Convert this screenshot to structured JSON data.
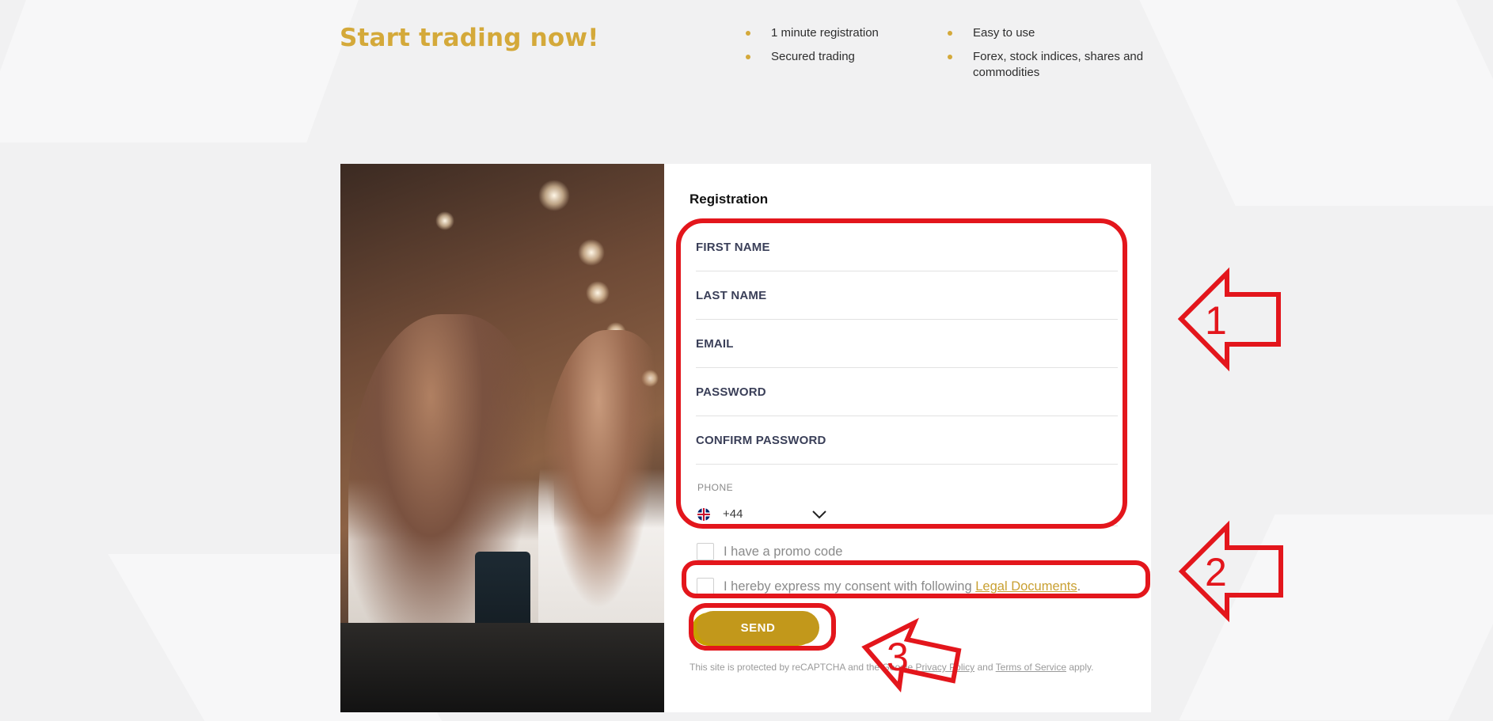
{
  "headline": "Start trading now!",
  "features": {
    "col1": [
      "1 minute registration",
      "Secured trading"
    ],
    "col2": [
      "Easy to use",
      "Forex, stock indices, shares and commodities"
    ]
  },
  "form": {
    "title": "Registration",
    "fields": [
      "FIRST NAME",
      "LAST NAME",
      "EMAIL",
      "PASSWORD",
      "CONFIRM PASSWORD"
    ],
    "phone_label": "PHONE",
    "dial_code": "+44",
    "promo_label": "I have a promo code",
    "consent_text": "I hereby express my consent with following ",
    "consent_link": "Legal Documents",
    "consent_end": ".",
    "send_label": "SEND",
    "recaptcha": {
      "prefix": "This site is protected by reCAPTCHA and the Google ",
      "privacy": "Privacy Policy",
      "and": " and ",
      "terms": "Terms of Service",
      "suffix": " apply."
    }
  },
  "annotations": [
    "1",
    "2",
    "3"
  ],
  "colors": {
    "accent": "#d4a93a",
    "button": "#c2981b",
    "annotation": "#e3161c"
  }
}
